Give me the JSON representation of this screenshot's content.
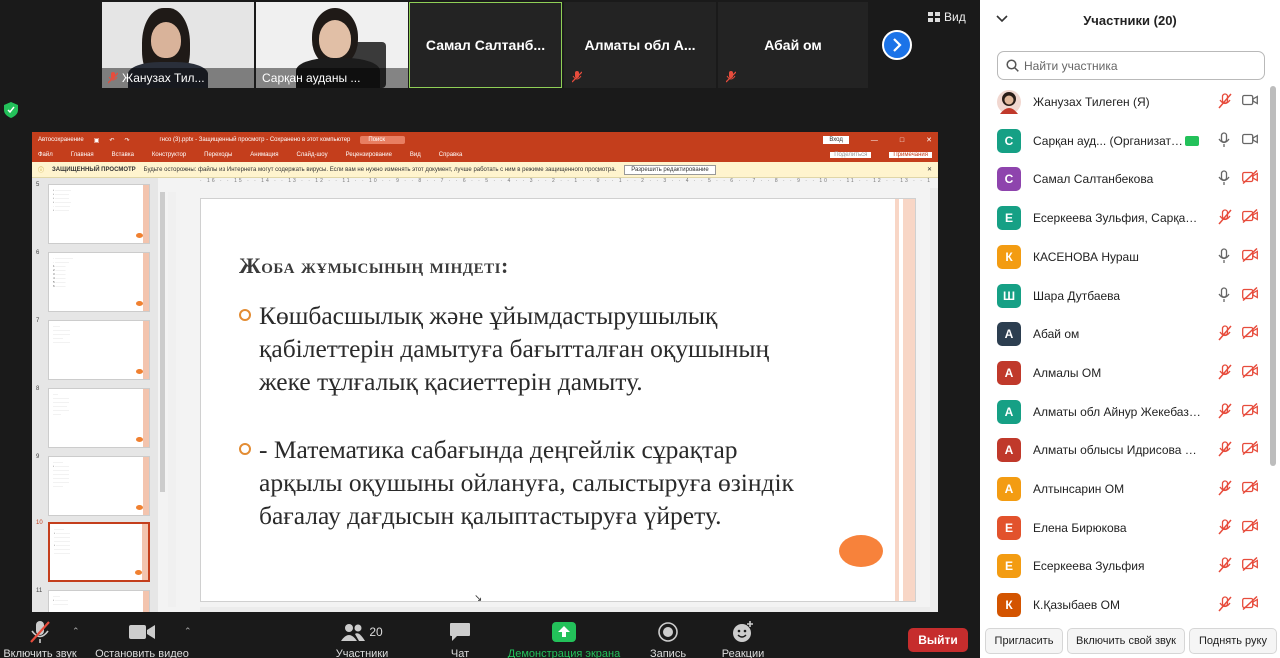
{
  "video_strip": {
    "view_label": "Вид",
    "tiles": [
      {
        "kind": "camera",
        "name": "Жанузах Тил..."
      },
      {
        "kind": "camera",
        "name": "Сарқан ауданы ..."
      },
      {
        "kind": "name",
        "name": "Самал  Салтанб..."
      },
      {
        "kind": "name",
        "name": "Алматы   обл А..."
      },
      {
        "kind": "name",
        "name": "Абай ом"
      }
    ]
  },
  "ppt": {
    "title_bar": {
      "autosave": "Автосохранение",
      "filename": "гнсо (3).pptx  -  Защищенный просмотр  -  Сохранено в этот компьютер",
      "search": "Поиск",
      "view_btn": "Вход"
    },
    "menu": [
      "Файл",
      "Главная",
      "Вставка",
      "Конструктор",
      "Переходы",
      "Анимация",
      "Слайд-шоу",
      "Рецензирование",
      "Вид",
      "Справка"
    ],
    "share": "Поделиться",
    "notes": "Примечания",
    "warning": {
      "label": "ЗАЩИЩЕННЫЙ ПРОСМОТР",
      "text": "Будьте осторожны: файлы из Интернета могут содержать вирусы. Если вам не нужно изменять этот документ, лучше работать с ним в режиме защищенного просмотра.",
      "button": "Разрешить редактирование"
    },
    "ruler": "· 16 · · 15 · · 14 · · 13 · · 12 · · 11 · · 10 · · 9 · · 8 · · 7 · · 6 · · 5 · · 4 · · 3 · · 2 · · 1 · · 0 · · 1 · · 2 · · 3 · · 4 · · 5 · · 6 · · 7 · · 8 · · 9 · · 10 · · 11 · · 12 · · 13 · · 14 · · 15 · · 16 ·",
    "slide_numbers": [
      "5",
      "6",
      "7",
      "8",
      "9",
      "10",
      "11"
    ],
    "slide": {
      "heading": "Жоба жұмысының міндеті:",
      "bullet1": "Көшбасшылық және ұйымдастырушылық қабілеттерін дамытуға бағытталған оқушының жеке тұлғалық қасиеттерін дамыту.",
      "bullet2": "-  Математика сабағында деңгейлік сұрақтар арқылы оқушыны ойлануға, салыстыруға өзіндік бағалау дағдысын қалыптастыруға үйрету."
    }
  },
  "toolbar": {
    "mute": "Включить звук",
    "video": "Остановить видео",
    "participants": "Участники",
    "participants_count": "20",
    "chat": "Чат",
    "share": "Демонстрация экрана",
    "record": "Запись",
    "reactions": "Реакции",
    "leave": "Выйти"
  },
  "panel": {
    "title": "Участники (20)",
    "search_placeholder": "Найти участника",
    "participants": [
      {
        "initial": "",
        "name": "Жанузах Тилеген (Я)",
        "color": "#c0392b",
        "mic": "off",
        "cam": "on",
        "photo": true
      },
      {
        "initial": "С",
        "name": "Сарқан ауд... (Организатор)",
        "color": "#16a085",
        "mic": "on",
        "cam": "on",
        "share": true
      },
      {
        "initial": "С",
        "name": "Самал Салтанбекова",
        "color": "#8e44ad",
        "mic": "on",
        "cam": "off"
      },
      {
        "initial": "Е",
        "name": "Есеркеева Зульфия, Сарқан ау...",
        "color": "#16a085",
        "mic": "off",
        "cam": "off"
      },
      {
        "initial": "К",
        "name": "КАСЕНОВА Нураш",
        "color": "#f39c12",
        "mic": "on",
        "cam": "off"
      },
      {
        "initial": "Ш",
        "name": "Шара Дутбаева",
        "color": "#16a085",
        "mic": "on",
        "cam": "off"
      },
      {
        "initial": "А",
        "name": "Абай ом",
        "color": "#2c3e50",
        "mic": "off",
        "cam": "off"
      },
      {
        "initial": "А",
        "name": "Алмалы ОМ",
        "color": "#c0392b",
        "mic": "off",
        "cam": "off"
      },
      {
        "initial": "А",
        "name": "Алматы  обл Айнур Жекебаза...",
        "color": "#16a085",
        "mic": "off",
        "cam": "off"
      },
      {
        "initial": "А",
        "name": "Алматы облысы Идрисова Сал...",
        "color": "#c0392b",
        "mic": "off",
        "cam": "off"
      },
      {
        "initial": "А",
        "name": "Алтынсарин ОМ",
        "color": "#f39c12",
        "mic": "off",
        "cam": "off"
      },
      {
        "initial": "Е",
        "name": "Елена Бирюкова",
        "color": "#e2522c",
        "mic": "off",
        "cam": "off"
      },
      {
        "initial": "Е",
        "name": "Есеркеева Зульфия",
        "color": "#f39c12",
        "mic": "off",
        "cam": "off"
      },
      {
        "initial": "К",
        "name": "К.Қазыбаев ОМ",
        "color": "#d35400",
        "mic": "off",
        "cam": "off"
      }
    ],
    "footer": {
      "invite": "Пригласить",
      "unmute_me": "Включить свой звук",
      "raise_hand": "Поднять руку"
    }
  }
}
